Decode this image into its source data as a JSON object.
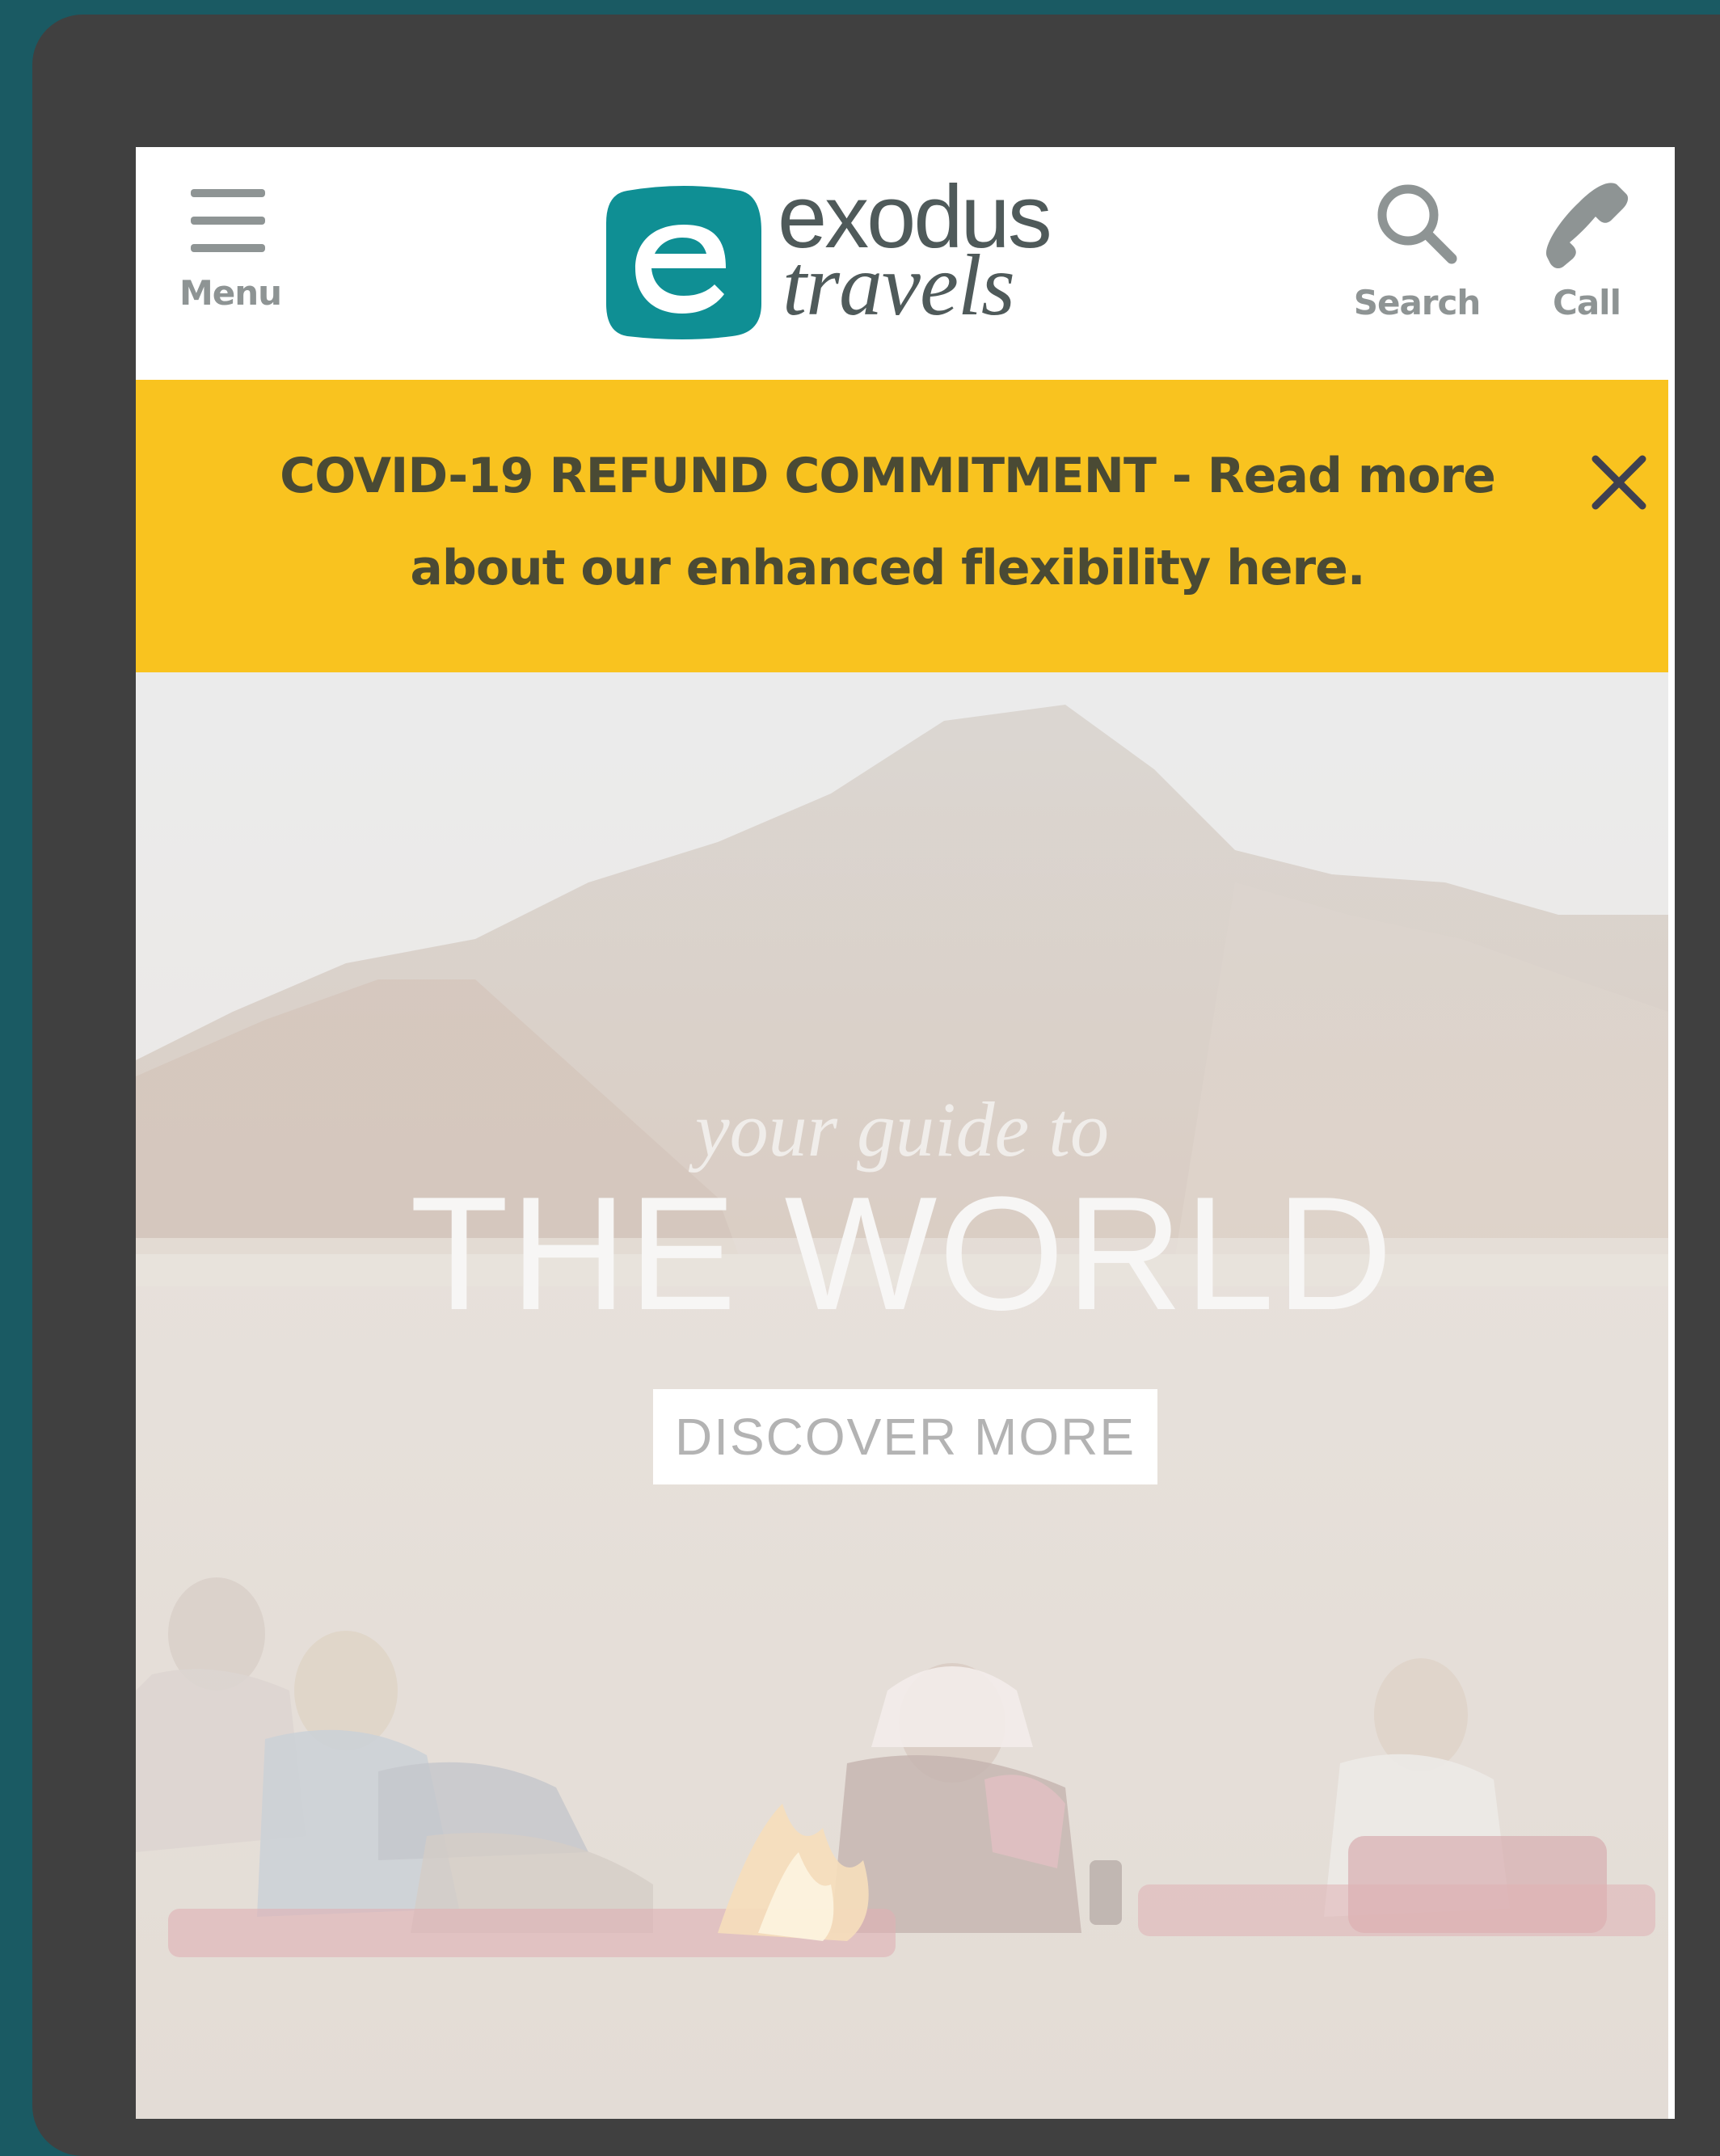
{
  "header": {
    "menu_label": "Menu",
    "search_label": "Search",
    "call_label": "Call",
    "logo_line1": "exodus",
    "logo_line2": "travels"
  },
  "banner": {
    "line1": "COVID-19 REFUND COMMITMENT - Read more",
    "line2": "about our enhanced flexibility here."
  },
  "hero": {
    "tagline": "your guide to",
    "heading": "THE WORLD",
    "cta_label": "DISCOVER MORE"
  },
  "colors": {
    "brand_teal": "#0f8f94",
    "banner_yellow": "#f9c31f",
    "frame_gray": "#404040",
    "header_icon_gray": "#8e9494"
  },
  "icons": {
    "menu": "hamburger-icon",
    "search": "search-icon",
    "call": "phone-icon",
    "close": "close-icon"
  }
}
